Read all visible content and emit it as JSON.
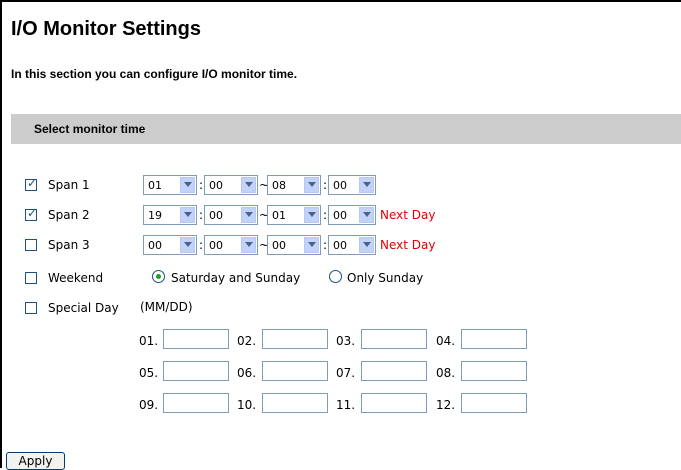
{
  "title": "I/O Monitor Settings",
  "intro": "In this section you can configure I/O monitor time.",
  "section_header": "Select monitor time",
  "spans": [
    {
      "label": "Span 1",
      "checked": true,
      "start_hour": "01",
      "start_min": "00",
      "end_hour": "08",
      "end_min": "00",
      "note": ""
    },
    {
      "label": "Span 2",
      "checked": true,
      "start_hour": "19",
      "start_min": "00",
      "end_hour": "01",
      "end_min": "00",
      "note": "Next Day"
    },
    {
      "label": "Span 3",
      "checked": false,
      "start_hour": "00",
      "start_min": "00",
      "end_hour": "00",
      "end_min": "00",
      "note": "Next Day"
    }
  ],
  "colon": ":",
  "tilde": "~",
  "weekend": {
    "label": "Weekend",
    "checked": false,
    "options": [
      "Saturday and Sunday",
      "Only Sunday"
    ],
    "selected": "Saturday and Sunday"
  },
  "special_day": {
    "label": "Special Day",
    "checked": false,
    "format_note": "(MM/DD)",
    "slots": [
      "01.",
      "02.",
      "03.",
      "04.",
      "05.",
      "06.",
      "07.",
      "08.",
      "09.",
      "10.",
      "11.",
      "12."
    ],
    "values": [
      "",
      "",
      "",
      "",
      "",
      "",
      "",
      "",
      "",
      "",
      "",
      ""
    ]
  },
  "apply_label": "Apply",
  "colors": {
    "section_bar": "#cccccc",
    "next_day": "#e00000",
    "radio_dot": "#21a121",
    "checkbox_border": "#1c5180"
  }
}
